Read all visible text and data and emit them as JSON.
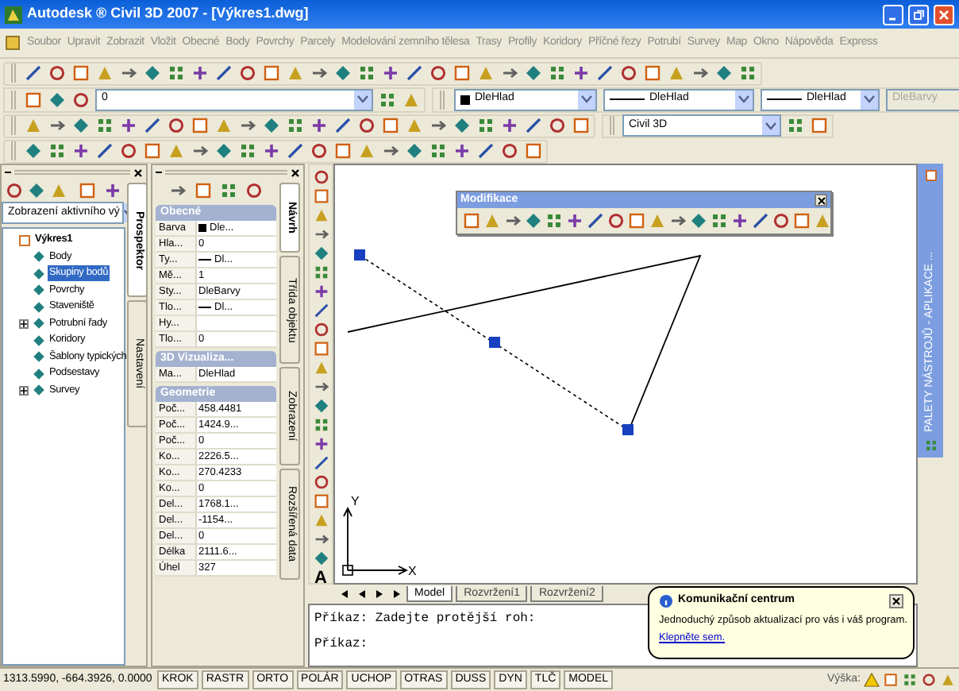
{
  "window": {
    "title": "Autodesk ® Civil 3D 2007 - [Výkres1.dwg]"
  },
  "menu": [
    "Soubor",
    "Upravit",
    "Zobrazit",
    "Vložit",
    "Obecné",
    "Body",
    "Povrchy",
    "Parcely",
    "Modelování zemního tělesa",
    "Trasy",
    "Profily",
    "Koridory",
    "Příčné řezy",
    "Potrubí",
    "Survey",
    "Map",
    "Okno",
    "Nápověda",
    "Express"
  ],
  "layer_toolbar": {
    "layer": "0",
    "color_control": "DleHlad",
    "linetype": "DleHlad",
    "lineweight": "DleHlad",
    "plot_style": {
      "value": "DleBarvy",
      "disabled": true
    }
  },
  "style_combo": {
    "value": "Civil 3D"
  },
  "prospector": {
    "view_select": "Zobrazení aktivního vý",
    "tree": [
      {
        "label": "Výkres1",
        "collapsed": false,
        "selected": false,
        "children": [
          {
            "label": "Body",
            "collapsed": false,
            "selected": false
          },
          {
            "label": "Skupiny bodů",
            "collapsed": false,
            "selected": true
          },
          {
            "label": "Povrchy",
            "collapsed": false,
            "selected": false
          },
          {
            "label": "Staveniště",
            "collapsed": false,
            "selected": false
          },
          {
            "label": "Potrubní řady",
            "collapsed": true,
            "selected": false
          },
          {
            "label": "Koridory",
            "collapsed": false,
            "selected": false
          },
          {
            "label": "Šablony typických",
            "collapsed": false,
            "selected": false
          },
          {
            "label": "Podsestavy",
            "collapsed": false,
            "selected": false
          },
          {
            "label": "Survey",
            "collapsed": true,
            "selected": false
          }
        ]
      }
    ],
    "tabs": [
      {
        "label": "Prospektor",
        "selected": true
      },
      {
        "label": "Nastavení",
        "selected": false
      }
    ]
  },
  "properties": {
    "sections": [
      {
        "title": "Obecné",
        "rows": [
          {
            "name": "Barva",
            "value": "Dle...",
            "kind": "color"
          },
          {
            "name": "Hla...",
            "value": "0",
            "kind": "text"
          },
          {
            "name": "Ty...",
            "value": "Dl...",
            "kind": "linetype"
          },
          {
            "name": "Mě...",
            "value": "1",
            "kind": "text"
          },
          {
            "name": "Sty...",
            "value": "DleBarvy",
            "kind": "text"
          },
          {
            "name": "Tlo...",
            "value": "Dl...",
            "kind": "linetype"
          },
          {
            "name": "Hy...",
            "kind": "text"
          },
          {
            "name": "Tlo...",
            "value": "0",
            "kind": "text"
          }
        ]
      },
      {
        "title": "3D Vizualiza...",
        "rows": [
          {
            "name": "Ma...",
            "value": "DleHlad",
            "kind": "text"
          }
        ]
      },
      {
        "title": "Geometrie",
        "rows": [
          {
            "name": "Poč...",
            "value": "458.4481",
            "kind": "text"
          },
          {
            "name": "Poč...",
            "value": "1424.9...",
            "kind": "text"
          },
          {
            "name": "Poč...",
            "value": "0",
            "kind": "text"
          },
          {
            "name": "Ko...",
            "value": "2226.5...",
            "kind": "text"
          },
          {
            "name": "Ko...",
            "value": "270.4233",
            "kind": "text"
          },
          {
            "name": "Ko...",
            "value": "0",
            "kind": "text"
          },
          {
            "name": "Del...",
            "value": "1768.1...",
            "kind": "text"
          },
          {
            "name": "Del...",
            "value": "-1154...",
            "kind": "text"
          },
          {
            "name": "Del...",
            "value": "0",
            "kind": "text"
          },
          {
            "name": "Délka",
            "value": "2111.6...",
            "kind": "text"
          },
          {
            "name": "Úhel",
            "value": "327",
            "kind": "text"
          }
        ]
      }
    ],
    "tabs": [
      {
        "label": "Návrh",
        "selected": true
      },
      {
        "label": "Třída objektu",
        "selected": false
      },
      {
        "label": "Zobrazení",
        "selected": false
      },
      {
        "label": "Rozšířená data",
        "selected": false
      }
    ]
  },
  "draw_toolbar": {
    "text_tool": "A"
  },
  "modify_toolbar": {
    "title": "Modifikace"
  },
  "ucs": {
    "x": "X",
    "y": "Y"
  },
  "tool_palette": {
    "title": "PALETY NÁSTROJŮ - APLIKACE ..."
  },
  "layout_tabs": [
    {
      "label": "Model",
      "selected": true
    },
    {
      "label": "Rozvržení1",
      "selected": false
    },
    {
      "label": "Rozvržení2",
      "selected": false
    }
  ],
  "command_lines": [
    "Příkaz: Zadejte protější roh:",
    "Příkaz:"
  ],
  "notification": {
    "title": "Komunikační centrum",
    "text": "Jednoduchý způsob aktualizací pro vás i váš program.",
    "link": "Klepněte sem."
  },
  "status_bar": {
    "coordinates": "1313.5990, -664.3926, 0.0000",
    "toggles": [
      "KROK",
      "RASTR",
      "ORTO",
      "POLÁR",
      "UCHOP",
      "OTRAS",
      "DUSS",
      "DYN",
      "TLČ",
      "MODEL"
    ],
    "height_label": "Výška:"
  }
}
